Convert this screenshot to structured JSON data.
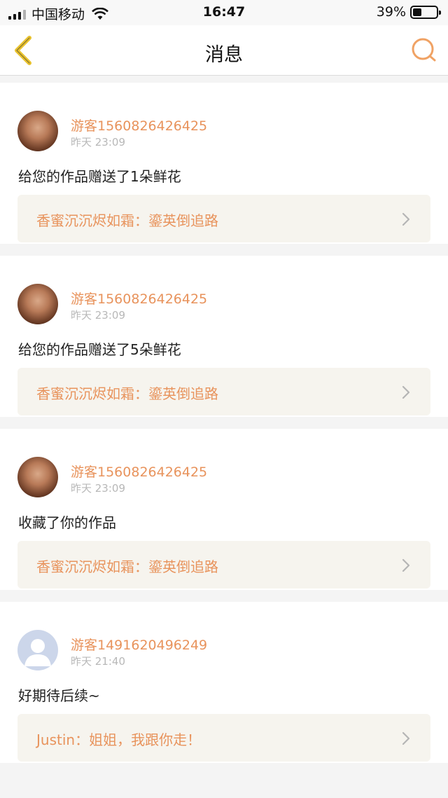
{
  "status_bar": {
    "carrier": "中国移动",
    "time": "16:47",
    "battery": "39%",
    "battery_level": 0.39
  },
  "header": {
    "title": "消息"
  },
  "messages": [
    {
      "username": "游客1560826426425",
      "time": "昨天 23:09",
      "content": "给您的作品赠送了1朵鲜花",
      "work": "香蜜沉沉烬如霜：鎏英倒追路",
      "avatar": "photo"
    },
    {
      "username": "游客1560826426425",
      "time": "昨天 23:09",
      "content": "给您的作品赠送了5朵鲜花",
      "work": "香蜜沉沉烬如霜：鎏英倒追路",
      "avatar": "photo"
    },
    {
      "username": "游客1560826426425",
      "time": "昨天 23:09",
      "content": "收藏了你的作品",
      "work": "香蜜沉沉烬如霜：鎏英倒追路",
      "avatar": "photo"
    },
    {
      "username": "游客1491620496249",
      "time": "昨天 21:40",
      "content": "好期待后续~",
      "work": "Justin：姐姐，我跟你走！",
      "avatar": "default"
    }
  ],
  "colors": {
    "accent": "#e8935c",
    "back_icon": "#e9c22e",
    "link_bg": "#f6f4ee"
  },
  "icons": {
    "back": "chevron-left-icon",
    "search": "search-icon",
    "forward": "chevron-right-icon"
  }
}
